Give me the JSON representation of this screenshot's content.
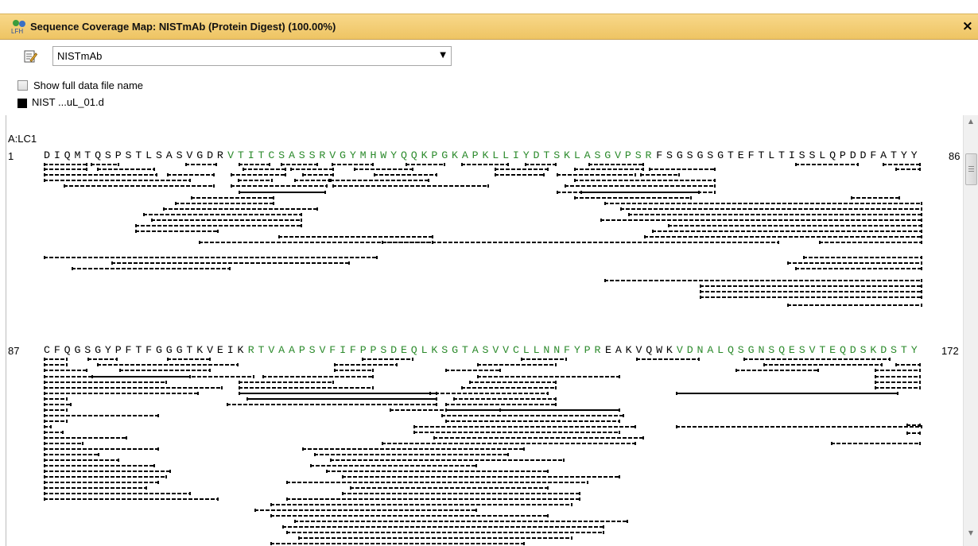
{
  "window": {
    "title": "Sequence Coverage Map: NISTmAb (Protein Digest) (100.00%)",
    "close": "×"
  },
  "toolbar": {
    "protein_select": {
      "value": "NISTmAb",
      "arrow": "▼"
    }
  },
  "options": {
    "show_full_name": "Show full data file name",
    "checked": false
  },
  "legend": {
    "file": "NIST ...uL_01.d",
    "color": "#000000"
  },
  "chain": {
    "label": "A:LC1"
  },
  "rows": [
    {
      "start": "1",
      "end": "86",
      "segments": [
        {
          "text": "DIQMTQSPSTLSASVGDR",
          "covered": false
        },
        {
          "text": "VTITCSASSRVGYMHWYQQKPGKAPKLLIYDTSKLASGVPSR",
          "covered": true
        },
        {
          "text": "FSGSGSGTEFTLTISSLQPDDFATYY",
          "covered": false
        }
      ]
    },
    {
      "start": "87",
      "end": "172",
      "segments": [
        {
          "text": "CFQGSGYPFTFGGGTKVEIK",
          "covered": false
        },
        {
          "text": "RTVAAPSVFIFPPSDEQLKSGTASVVCLLNNFYPR",
          "covered": true
        },
        {
          "text": "EAKVQWK",
          "covered": false
        },
        {
          "text": "VDNALQSGNSQESVTEQDSKDSTY",
          "covered": true
        }
      ]
    }
  ],
  "colors": {
    "title_bar": "#f3ce74",
    "covered": "#2b8a2b",
    "uncovered": "#000000"
  },
  "icons": {
    "title": "analysis-icon",
    "edit": "edit-icon",
    "scroll_up": "▲",
    "scroll_down": "▼"
  }
}
